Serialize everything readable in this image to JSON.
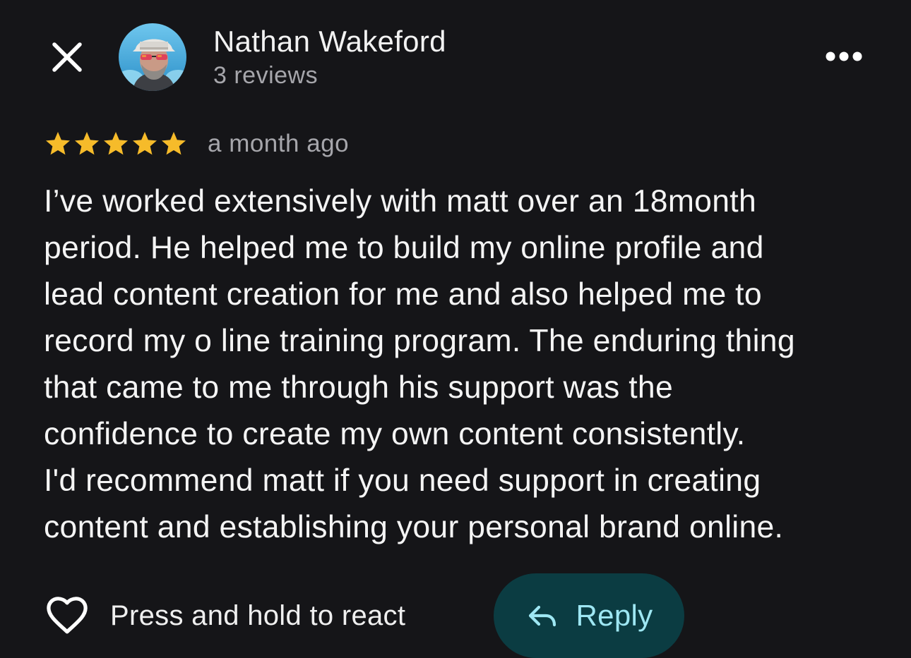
{
  "header": {
    "close_icon": "close-icon",
    "avatar_alt": "Nathan Wakeford",
    "author_name": "Nathan Wakeford",
    "review_count": "3 reviews",
    "more_icon": "more-horizontal-icon"
  },
  "review": {
    "rating": 5,
    "rating_max": 5,
    "star_color": "#f6bb2a",
    "timestamp": "a month ago",
    "text_lines": [
      "I’ve worked extensively with matt over an 18month",
      "period. He helped me to build my online profile and",
      "lead content creation for me and also helped me to",
      "record my o line training program. The enduring thing",
      "that came to me through his support was the",
      "confidence to create my own content consistently.",
      "I'd recommend matt if you need support in creating",
      "content and establishing your personal brand online."
    ]
  },
  "actions": {
    "react_icon": "heart-outline-icon",
    "react_label": "Press and hold to react",
    "reply_icon": "reply-arrow-icon",
    "reply_label": "Reply",
    "reply_bg_color": "#0b3c42",
    "reply_text_color": "#9ee7f3"
  }
}
